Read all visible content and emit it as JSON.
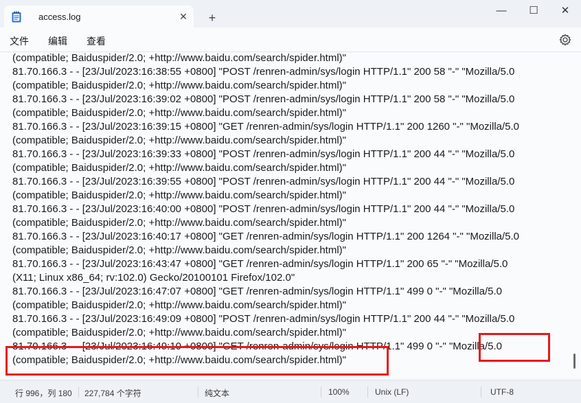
{
  "tab": {
    "title": "access.log",
    "close": "✕",
    "new": "+"
  },
  "window": {
    "minimize": "—",
    "maximize": "☐",
    "close": "✕"
  },
  "menu": {
    "file": "文件",
    "edit": "编辑",
    "view": "查看"
  },
  "icons": {
    "settings": "gear-icon",
    "app": "notepad-icon"
  },
  "log_lines": [
    "(compatible; Baiduspider/2.0; +http://www.baidu.com/search/spider.html)\"",
    "81.70.166.3 - - [23/Jul/2023:16:38:55 +0800] \"POST /renren-admin/sys/login HTTP/1.1\" 200 58 \"-\" \"Mozilla/5.0",
    "(compatible; Baiduspider/2.0; +http://www.baidu.com/search/spider.html)\"",
    "81.70.166.3 - - [23/Jul/2023:16:39:02 +0800] \"POST /renren-admin/sys/login HTTP/1.1\" 200 58 \"-\" \"Mozilla/5.0",
    "(compatible; Baiduspider/2.0; +http://www.baidu.com/search/spider.html)\"",
    "81.70.166.3 - - [23/Jul/2023:16:39:15 +0800] \"GET /renren-admin/sys/login HTTP/1.1\" 200 1260 \"-\" \"Mozilla/5.0",
    "(compatible; Baiduspider/2.0; +http://www.baidu.com/search/spider.html)\"",
    "81.70.166.3 - - [23/Jul/2023:16:39:33 +0800] \"POST /renren-admin/sys/login HTTP/1.1\" 200 44 \"-\" \"Mozilla/5.0",
    "(compatible; Baiduspider/2.0; +http://www.baidu.com/search/spider.html)\"",
    "81.70.166.3 - - [23/Jul/2023:16:39:55 +0800] \"POST /renren-admin/sys/login HTTP/1.1\" 200 44 \"-\" \"Mozilla/5.0",
    "(compatible; Baiduspider/2.0; +http://www.baidu.com/search/spider.html)\"",
    "81.70.166.3 - - [23/Jul/2023:16:40:00 +0800] \"POST /renren-admin/sys/login HTTP/1.1\" 200 44 \"-\" \"Mozilla/5.0",
    "(compatible; Baiduspider/2.0; +http://www.baidu.com/search/spider.html)\"",
    "81.70.166.3 - - [23/Jul/2023:16:40:17 +0800] \"GET /renren-admin/sys/login HTTP/1.1\" 200 1264 \"-\" \"Mozilla/5.0",
    "(compatible; Baiduspider/2.0; +http://www.baidu.com/search/spider.html)\"",
    "81.70.166.3 - - [23/Jul/2023:16:43:47 +0800] \"GET /renren-admin/sys/login HTTP/1.1\" 200 65 \"-\" \"Mozilla/5.0",
    "(X11; Linux x86_64; rv:102.0) Gecko/20100101 Firefox/102.0\"",
    "81.70.166.3 - - [23/Jul/2023:16:47:07 +0800] \"GET /renren-admin/sys/login HTTP/1.1\" 499 0 \"-\" \"Mozilla/5.0",
    "(compatible; Baiduspider/2.0; +http://www.baidu.com/search/spider.html)\"",
    "81.70.166.3 - - [23/Jul/2023:16:49:09 +0800] \"POST /renren-admin/sys/login HTTP/1.1\" 200 44 \"-\" \"Mozilla/5.0",
    "(compatible; Baiduspider/2.0; +http://www.baidu.com/search/spider.html)\"",
    "81.70.166.3 - - [23/Jul/2023:16:49:10 +0800] \"GET /renren-admin/sys/login HTTP/1.1\" 499 0 \"-\" \"Mozilla/5.0",
    "(compatible; Baiduspider/2.0; +http://www.baidu.com/search/spider.html)\""
  ],
  "status": {
    "position": "行 996，列 180",
    "chars": "227,784 个字符",
    "format": "纯文本",
    "zoom": "100%",
    "line_ending": "Unix (LF)",
    "encoding": "UTF-8"
  },
  "colors": {
    "highlight": "#e81717",
    "editor_bg": "#fafbfd",
    "chrome_bg": "#eef1f6"
  }
}
